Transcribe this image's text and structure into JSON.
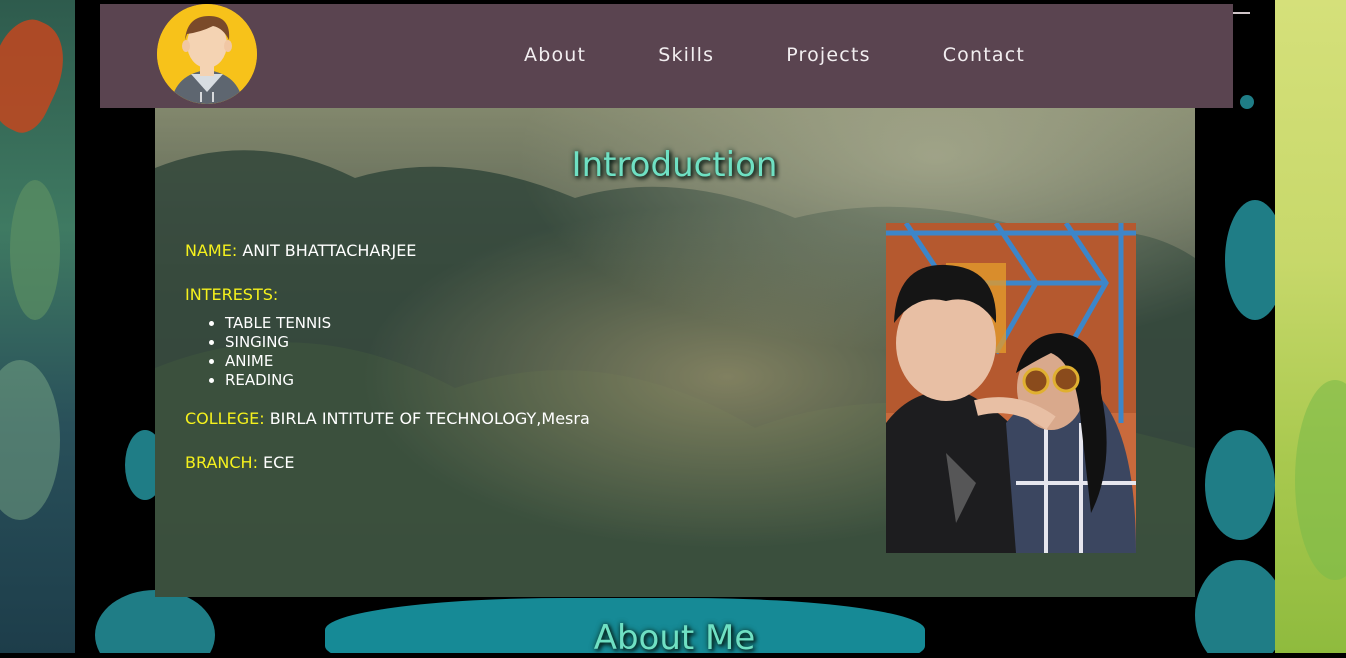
{
  "nav": {
    "links": [
      "About",
      "Skills",
      "Projects",
      "Contact"
    ]
  },
  "intro": {
    "title": "Introduction",
    "name_label": "NAME:",
    "name_value": "ANIT BHATTACHARJEE",
    "interests_label": "INTERESTS:",
    "interests": [
      "TABLE TENNIS",
      "SINGING",
      "ANIME",
      "READING"
    ],
    "college_label": "COLLEGE:",
    "college_value": "BIRLA INTITUTE OF TECHNOLOGY,Mesra",
    "branch_label": "BRANCH:",
    "branch_value": "ECE"
  },
  "about": {
    "title": "About Me"
  },
  "colors": {
    "nav_bg": "#5a4450",
    "title": "#6fe0c3",
    "label": "#f5f11d",
    "avatar_bg": "#f7c21a"
  }
}
